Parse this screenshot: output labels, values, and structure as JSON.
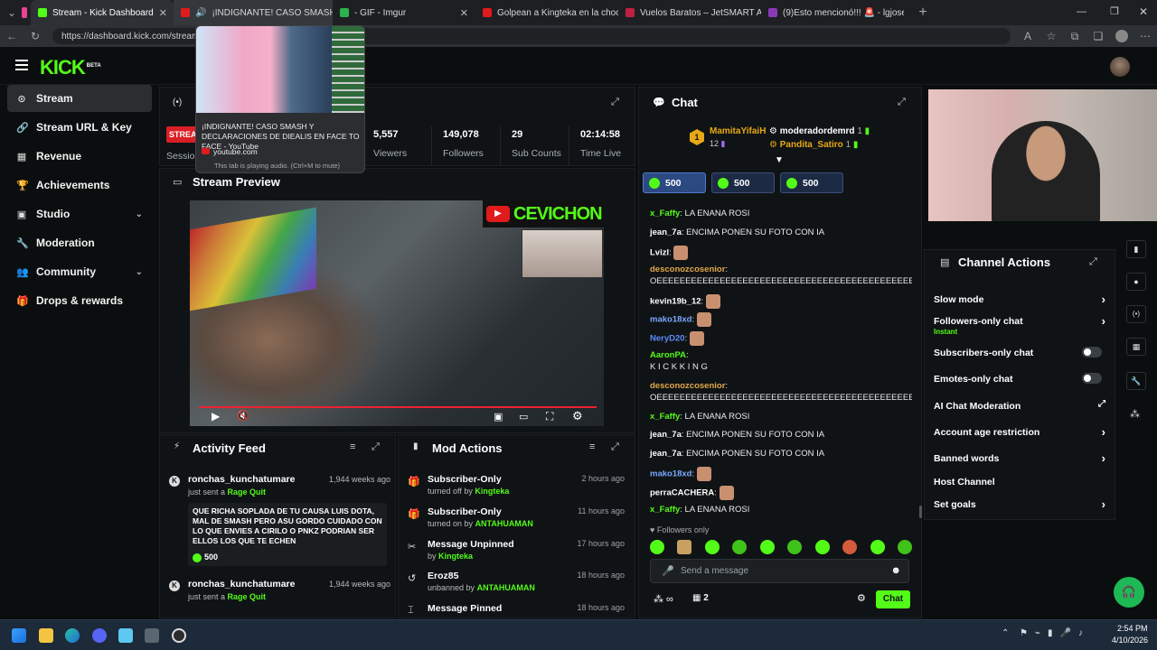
{
  "browser": {
    "tabs": [
      {
        "title": "Stream - Kick Dashboard",
        "active": true
      },
      {
        "title": "¡INDIGNANTE! CASO SMASH",
        "active": false
      },
      {
        "title": "- GIF - Imgur",
        "active": false
      },
      {
        "title": "Golpean a Kingteka en la chocolat",
        "active": false
      },
      {
        "title": "Vuelos Baratos – JetSMART Avione",
        "active": false
      },
      {
        "title": "(9)Esto mencionó!!! 🚨 - lgjosepe",
        "active": false
      }
    ],
    "url": "https://dashboard.kick.com/stream",
    "tooltip": {
      "title": "¡INDIGNANTE! CASO SMASH Y DECLARACIONES DE DIEALIS EN FACE TO FACE - YouTube",
      "domain": "youtube.com",
      "note": "This tab is playing audio. (Ctrl+M to mute)"
    }
  },
  "app": {
    "logo": "KICK",
    "logo_badge": "BETA"
  },
  "sidebar": {
    "items": [
      {
        "label": "Stream",
        "icon": "broadcast-icon",
        "active": true
      },
      {
        "label": "Stream URL & Key",
        "icon": "link-icon"
      },
      {
        "label": "Revenue",
        "icon": "bank-icon"
      },
      {
        "label": "Achievements",
        "icon": "trophy-icon"
      },
      {
        "label": "Studio",
        "icon": "studio-icon",
        "chevron": true
      },
      {
        "label": "Moderation",
        "icon": "wrench-icon"
      },
      {
        "label": "Community",
        "icon": "users-icon",
        "chevron": true
      },
      {
        "label": "Drops & rewards",
        "icon": "gift-icon"
      }
    ]
  },
  "stream_info": {
    "badge": "STREAM",
    "session_label": "Session",
    "stats": [
      {
        "value": "5,557",
        "label": "Viewers"
      },
      {
        "value": "149,078",
        "label": "Followers"
      },
      {
        "value": "29",
        "label": "Sub Counts"
      },
      {
        "value": "02:14:58",
        "label": "Time Live"
      }
    ]
  },
  "stream_preview": {
    "title": "Stream Preview",
    "overlay_text": "CEVICHON"
  },
  "activity_feed": {
    "title": "Activity Feed",
    "items": [
      {
        "user": "ronchas_kunchatumare",
        "time": "1,944 weeks ago",
        "action": "just sent a",
        "item": "Rage Quit",
        "message": "QUE RICHA SOPLADA DE TU CAUSA LUIS DOTA, MAL DE SMASH PERO ASU GORDO CUIDADO CON LO QUE ENVIES A CIRILO O PNKZ PODRIAN SER ELLOS LOS QUE TE ECHEN",
        "amount": "500"
      },
      {
        "user": "ronchas_kunchatumare",
        "time": "1,944 weeks ago",
        "action": "just sent a",
        "item": "Rage Quit"
      }
    ]
  },
  "mod_actions": {
    "title": "Mod Actions",
    "items": [
      {
        "title": "Subscriber-Only",
        "detail": "turned off by",
        "by": "Kingteka",
        "time": "2 hours ago",
        "icon": "gift-icon"
      },
      {
        "title": "Subscriber-Only",
        "detail": "turned on by",
        "by": "ANTAHUAMAN",
        "time": "11 hours ago",
        "icon": "gift-icon"
      },
      {
        "title": "Message Unpinned",
        "detail": "by",
        "by": "Kingteka",
        "time": "17 hours ago",
        "icon": "unpin-icon"
      },
      {
        "title": "Eroz85",
        "detail": "unbanned by",
        "by": "ANTAHUAMAN",
        "time": "18 hours ago",
        "icon": "undo-icon"
      },
      {
        "title": "Message Pinned",
        "detail": "",
        "by": "",
        "time": "18 hours ago",
        "icon": "pin-icon"
      }
    ]
  },
  "chat": {
    "title": "Chat",
    "top_gifters": [
      {
        "rank": "1",
        "name": "MamitaYifaiH",
        "count": "12"
      },
      {
        "name": "moderadordemrd",
        "count": "1"
      },
      {
        "name": "Pandita_Satiro",
        "count": "1"
      }
    ],
    "gift_amounts": [
      "500",
      "500",
      "500"
    ],
    "messages": [
      {
        "user": "x_Faffy",
        "color": "#53fc18",
        "text": "LA ENANA ROSI"
      },
      {
        "user": "jean_7a",
        "color": "#ffffff",
        "text": "ENCIMA PONEN SU FOTO CON IA"
      },
      {
        "user": "Lvizl",
        "color": "#ffffff",
        "text": "",
        "emote": true
      },
      {
        "user": "desconozcosenior",
        "color": "#e0a84a",
        "text": "OEEEEEEEEEEEEEEEEEEEEEEEEEEEEEEEEEEEEEEEEEEEEEEE",
        "wrap": true
      },
      {
        "user": "kevin19b_12",
        "color": "#ffffff",
        "text": "",
        "emote": true
      },
      {
        "user": "mako18xd",
        "color": "#7aa8ff",
        "text": "",
        "emote": true
      },
      {
        "user": "NeryD20",
        "color": "#5b8cff",
        "text": "",
        "emote": true
      },
      {
        "user": "AaronPA",
        "color": "#53fc18",
        "text": "K I C K K I N G",
        "wrap": true
      },
      {
        "user": "desconozcosenior",
        "color": "#e0a84a",
        "text": "OEEEEEEEEEEEEEEEEEEEEEEEEEEEEEEEEEEEEEEEEEEEEEEE",
        "wrap": true
      },
      {
        "user": "x_Faffy",
        "color": "#53fc18",
        "text": "LA ENANA ROSI"
      },
      {
        "user": "jean_7a",
        "color": "#ffffff",
        "text": "ENCIMA PONEN SU FOTO CON IA"
      },
      {
        "user": "jean_7a",
        "color": "#ffffff",
        "text": "ENCIMA PONEN SU FOTO CON IA"
      },
      {
        "user": "mako18xd",
        "color": "#7aa8ff",
        "text": "",
        "emote": true
      },
      {
        "user": "perraCACHERA",
        "color": "#ffffff",
        "text": "",
        "emote": true
      },
      {
        "user": "x_Faffy",
        "color": "#53fc18",
        "text": "LA ENANA ROSI"
      }
    ],
    "mode_label": "Followers only",
    "input_placeholder": "Send a message",
    "viewer_count": "2",
    "send_label": "Chat"
  },
  "channel_actions": {
    "title": "Channel Actions",
    "items": [
      {
        "label": "Slow mode",
        "type": "arrow"
      },
      {
        "label": "Followers-only chat",
        "sub": "Instant",
        "type": "arrow"
      },
      {
        "label": "Subscribers-only chat",
        "type": "toggle"
      },
      {
        "label": "Emotes-only chat",
        "type": "toggle"
      },
      {
        "label": "AI Chat Moderation",
        "type": "external"
      },
      {
        "label": "Account age restriction",
        "type": "arrow"
      },
      {
        "label": "Banned words",
        "type": "arrow"
      },
      {
        "label": "Host Channel",
        "type": "none"
      },
      {
        "label": "Set goals",
        "type": "arrow"
      }
    ]
  },
  "taskbar": {
    "time": "2:54 PM",
    "date": "4/10/2026"
  },
  "colors": {
    "brand": "#53fc18",
    "bg": "#0b0e0f",
    "panel": "#101315"
  }
}
